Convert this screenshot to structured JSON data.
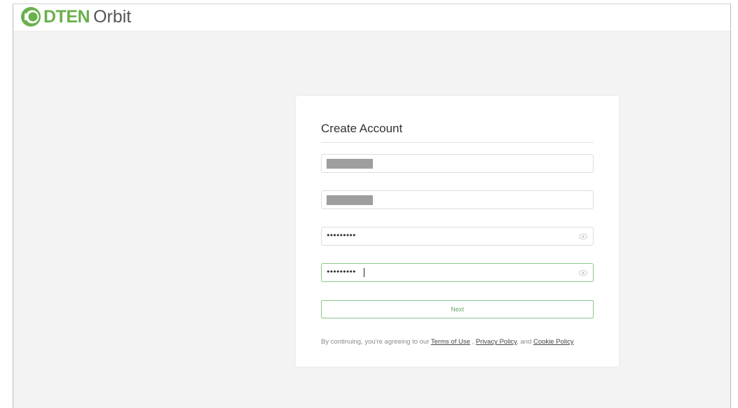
{
  "header": {
    "logo_brand": "DTEN",
    "logo_product": "Orbit",
    "brand_color": "#6ab04c"
  },
  "form": {
    "title": "Create Account",
    "fields": [
      {
        "name": "first-name",
        "value": "",
        "redacted": true
      },
      {
        "name": "last-name",
        "value": "",
        "redacted": true
      },
      {
        "name": "password",
        "value": "•••••••••",
        "icon": "eye-icon"
      },
      {
        "name": "confirm-password",
        "value": "•••••••••",
        "icon": "eye-icon",
        "focused": true
      }
    ],
    "next_label": "Next"
  },
  "legal": {
    "prefix": "By continuing, you're agreeing to our",
    "terms": "Terms of Use",
    "sep": ",",
    "privacy": "Privacy Policy",
    "and": ", and",
    "cookie": "Cookie Policy"
  }
}
